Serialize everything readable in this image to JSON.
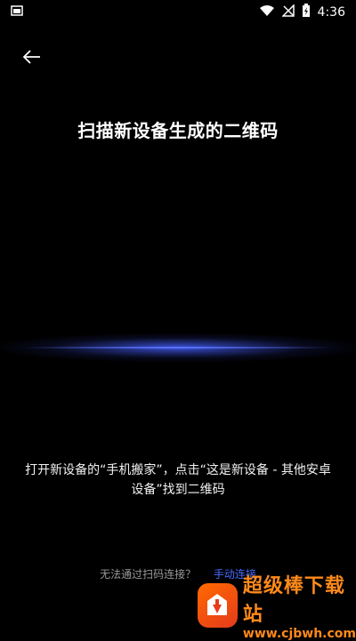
{
  "status_bar": {
    "time": "4:36",
    "icons": [
      "app-notification-icon",
      "wifi-icon",
      "signal-off-icon",
      "battery-charging-icon"
    ]
  },
  "header": {
    "back_icon": "back-arrow-icon",
    "title": "扫描新设备生成的二维码"
  },
  "instruction": "打开新设备的“手机搬家”，点击“这是新设备 - 其他安卓设备”找到二维码",
  "bottom": {
    "cannot_scan": "无法通过扫码连接？",
    "manual_link": "手动连接"
  },
  "watermark": {
    "title": "超级棒下载站",
    "url": "www.cjbwh.com"
  },
  "colors": {
    "background": "#000000",
    "accent": "#4a6bff",
    "muted": "#9a9a9a",
    "watermark": "#ff8a1a"
  }
}
